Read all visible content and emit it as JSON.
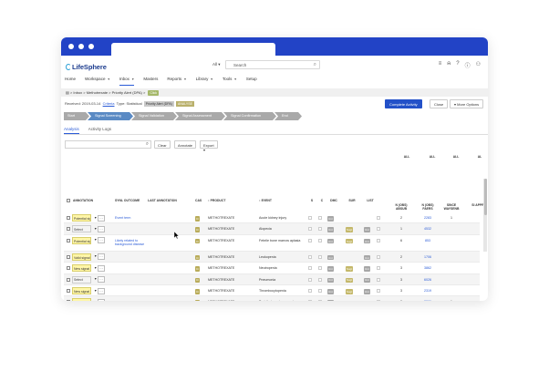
{
  "app": {
    "brand": "LifeSphere",
    "search": {
      "scope": "All",
      "placeholder": "Search"
    }
  },
  "nav": [
    {
      "label": "Home",
      "caret": false,
      "active": false
    },
    {
      "label": "Workspace",
      "caret": true,
      "active": false
    },
    {
      "label": "Inbox",
      "caret": true,
      "active": true
    },
    {
      "label": "Masters",
      "caret": false,
      "active": false
    },
    {
      "label": "Reports",
      "caret": true,
      "active": false
    },
    {
      "label": "Library",
      "caret": true,
      "active": false
    },
    {
      "label": "Tools",
      "caret": true,
      "active": false
    },
    {
      "label": "Setup",
      "caret": false,
      "active": false
    }
  ],
  "breadcrumb": {
    "text": "> Inbox > Methotrexate > Priority Alert (DPA) >",
    "badge": "Click"
  },
  "meta": {
    "received": "Received: 2019-03-14",
    "criteria": "Criteria",
    "type_label": "Type: Statistical",
    "tag1": "Priority Alert (DPA)",
    "tag2": "ANALYSE"
  },
  "actions": {
    "complete": "Complete Activity",
    "close": "Close",
    "more": "More Options"
  },
  "workflow": [
    "Start",
    "Signal Screening",
    "Signal Validation",
    "Signal Assessment",
    "Signal Confirmation",
    "End"
  ],
  "tabs": [
    "Analysis",
    "Activity Logs"
  ],
  "toolbar": {
    "clear": "Clear",
    "annotate": "Annotate",
    "export": "Export"
  },
  "table": {
    "group_headers": [
      "ALL",
      "ALL",
      "ALL",
      "AL"
    ],
    "columns": [
      "ANNOTATION",
      "SYNL OUTCOME",
      "LAST ANNOTATION",
      "CAS",
      "↕ PRODUCT",
      "↕ EVENT",
      "S",
      "C",
      "DMC",
      "SUR",
      "LIST",
      "N (OBS) ABSUB",
      "N (OBS) FAERS",
      "SINCE WAYSENB",
      "SI APPR"
    ],
    "rows": [
      {
        "annotation": "Potential sig",
        "highlight": true,
        "outcome": "Event term",
        "outcome_link": true,
        "cas": "Ci",
        "product": "METHOTREXATE",
        "event": "Acute kidney injury",
        "dmc": "Unt",
        "sur": "",
        "list": "",
        "n_absub": "2",
        "n_faers": "2283",
        "since": "1"
      },
      {
        "annotation": "Select",
        "highlight": false,
        "outcome": "",
        "outcome_link": false,
        "cas": "Ci",
        "product": "METHOTREXATE",
        "event": "Alopecia",
        "dmc": "Unt",
        "sur": "Sugt",
        "list": "Unt",
        "n_absub": "1",
        "n_faers": "4532",
        "since": ""
      },
      {
        "annotation": "Potential sig",
        "highlight": true,
        "outcome": "Likely related to background disease",
        "outcome_link": true,
        "cas": "Ci",
        "product": "METHOTREXATE",
        "event": "Febrile bone marrow aplasia",
        "dmc": "Unt",
        "sur": "Sugt",
        "list": "Unt",
        "n_absub": "6",
        "n_faers": "853",
        "since": ""
      },
      {
        "annotation": "Valid signal",
        "highlight": true,
        "outcome": "",
        "outcome_link": false,
        "cas": "Ci",
        "product": "METHOTREXATE",
        "event": "Leukopenia",
        "dmc": "Unt",
        "sur": "",
        "list": "Unt",
        "n_absub": "2",
        "n_faers": "1706",
        "since": ""
      },
      {
        "annotation": "New signal",
        "highlight": true,
        "outcome": "",
        "outcome_link": false,
        "cas": "Ci",
        "product": "METHOTREXATE",
        "event": "Neutropenia",
        "dmc": "Unt",
        "sur": "Sugt",
        "list": "Unt",
        "n_absub": "3",
        "n_faers": "3862",
        "since": ""
      },
      {
        "annotation": "Select",
        "highlight": false,
        "outcome": "",
        "outcome_link": false,
        "cas": "Ci",
        "product": "METHOTREXATE",
        "event": "Pneumonia",
        "dmc": "Unt",
        "sur": "Sugt",
        "list": "Unt",
        "n_absub": "3",
        "n_faers": "6026",
        "since": ""
      },
      {
        "annotation": "New signal",
        "highlight": true,
        "outcome": "",
        "outcome_link": false,
        "cas": "Ci",
        "product": "METHOTREXATE",
        "event": "Thrombocytopenia",
        "dmc": "Unt",
        "sur": "Sugt",
        "list": "Unt",
        "n_absub": "3",
        "n_faers": "2319",
        "since": ""
      },
      {
        "annotation": "Further Eva",
        "highlight": true,
        "outcome": "",
        "outcome_link": false,
        "cas": "Ci",
        "product": "METHOTREXATE",
        "event": "Toxicity to various agents",
        "dmc": "Unt",
        "sur": "",
        "list": "",
        "n_absub": "2",
        "n_faers": "2389",
        "since": "1"
      }
    ]
  },
  "colors": {
    "chrome": "#2243c6",
    "primary": "#2351c8",
    "workflow_active": "#5a8ac4",
    "workflow": "#a9a9a9",
    "annotation_highlight": "#fff6a8"
  }
}
